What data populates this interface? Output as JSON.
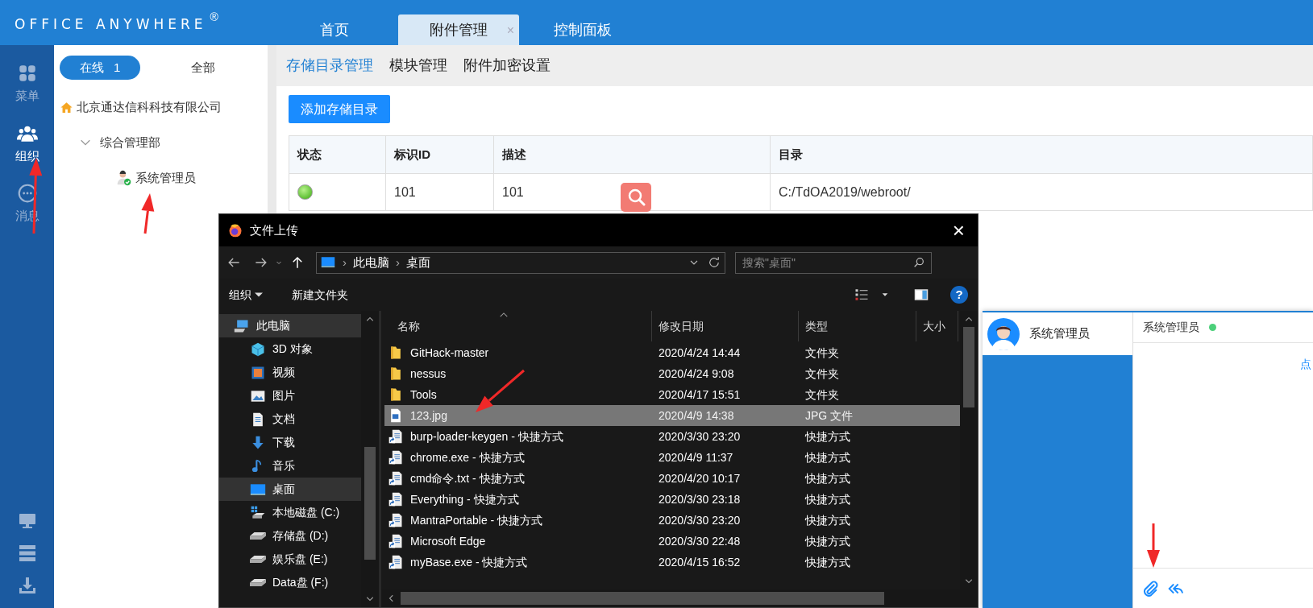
{
  "app": {
    "logo": "OFFICE ANYWHERE",
    "logo_mark": "®"
  },
  "tabs": [
    {
      "label": "首页",
      "selected": false
    },
    {
      "label": "附件管理",
      "selected": true,
      "close": "×"
    },
    {
      "label": "控制面板",
      "selected": false
    }
  ],
  "rail": [
    {
      "label": "菜单",
      "selected": false
    },
    {
      "label": "组织",
      "selected": true
    },
    {
      "label": "消息",
      "selected": false
    }
  ],
  "org": {
    "filters": [
      {
        "label": "在线",
        "count": "1",
        "selected": true
      },
      {
        "label": "全部",
        "selected": false
      }
    ],
    "tree": [
      {
        "label": "北京通达信科科技有限公司",
        "kind": "company",
        "children": [
          {
            "label": "综合管理部",
            "kind": "dept",
            "expanded": true,
            "children": [
              {
                "label": "系统管理员",
                "kind": "user"
              }
            ]
          }
        ]
      }
    ]
  },
  "subtabs": [
    {
      "label": "存储目录管理",
      "selected": true
    },
    {
      "label": "模块管理",
      "selected": false
    },
    {
      "label": "附件加密设置",
      "selected": false
    }
  ],
  "add_button": "添加存储目录",
  "table": {
    "columns": [
      "状态",
      "标识ID",
      "描述",
      "目录"
    ],
    "rows": [
      {
        "active": true,
        "id": "101",
        "desc": "101",
        "dir": "C:/TdOA2019/webroot/"
      }
    ]
  },
  "dialog": {
    "title": "文件上传",
    "close": "×",
    "path": [
      {
        "sep": "›",
        "label": "此电脑"
      },
      {
        "sep": "›",
        "label": "桌面"
      }
    ],
    "search": {
      "placeholder": "搜索\"桌面\""
    },
    "help": "?",
    "commands": [
      {
        "label": "组织",
        "dropdown": true
      },
      {
        "label": "新建文件夹",
        "dropdown": false
      }
    ],
    "nav": [
      {
        "label": "此电脑",
        "selected": true,
        "children": [
          {
            "label": "3D 对象",
            "selected": false
          },
          {
            "label": "视频",
            "selected": false
          },
          {
            "label": "图片",
            "selected": false
          },
          {
            "label": "文档",
            "selected": false
          },
          {
            "label": "下载",
            "selected": false
          },
          {
            "label": "音乐",
            "selected": false
          },
          {
            "label": "桌面",
            "selected": true
          },
          {
            "label": "本地磁盘 (C:)",
            "selected": false
          },
          {
            "label": "存储盘 (D:)",
            "selected": false
          },
          {
            "label": "娱乐盘 (E:)",
            "selected": false
          },
          {
            "label": "Data盘 (F:)",
            "selected": false
          }
        ]
      }
    ],
    "columns": [
      "名称",
      "修改日期",
      "类型",
      "大小"
    ],
    "files": [
      {
        "name": "GitHack-master",
        "date": "2020/4/24 14:44",
        "type": "文件夹",
        "kind": "folder",
        "selected": false
      },
      {
        "name": "nessus",
        "date": "2020/4/24 9:08",
        "type": "文件夹",
        "kind": "folder",
        "selected": false
      },
      {
        "name": "Tools",
        "date": "2020/4/17 15:51",
        "type": "文件夹",
        "kind": "folder",
        "selected": false
      },
      {
        "name": "123.jpg",
        "date": "2020/4/9 14:38",
        "type": "JPG 文件",
        "kind": "image",
        "selected": true
      },
      {
        "name": "burp-loader-keygen - 快捷方式",
        "date": "2020/3/30 23:20",
        "type": "快捷方式",
        "kind": "shortcut",
        "selected": false
      },
      {
        "name": "chrome.exe - 快捷方式",
        "date": "2020/4/9 11:37",
        "type": "快捷方式",
        "kind": "shortcut",
        "selected": false
      },
      {
        "name": "cmd命令.txt - 快捷方式",
        "date": "2020/4/20 10:17",
        "type": "快捷方式",
        "kind": "shortcut",
        "selected": false
      },
      {
        "name": "Everything - 快捷方式",
        "date": "2020/3/30 23:18",
        "type": "快捷方式",
        "kind": "shortcut",
        "selected": false
      },
      {
        "name": "MantraPortable - 快捷方式",
        "date": "2020/3/30 23:20",
        "type": "快捷方式",
        "kind": "shortcut",
        "selected": false
      },
      {
        "name": "Microsoft Edge",
        "date": "2020/3/30 22:48",
        "type": "快捷方式",
        "kind": "shortcut",
        "selected": false
      },
      {
        "name": "myBase.exe - 快捷方式",
        "date": "2020/4/15 16:52",
        "type": "快捷方式",
        "kind": "shortcut",
        "selected": false
      }
    ]
  },
  "chat": {
    "contacts": [
      {
        "name": "系统管理员",
        "selected": true
      }
    ],
    "header": "系统管理员",
    "online": true,
    "link": "点"
  }
}
